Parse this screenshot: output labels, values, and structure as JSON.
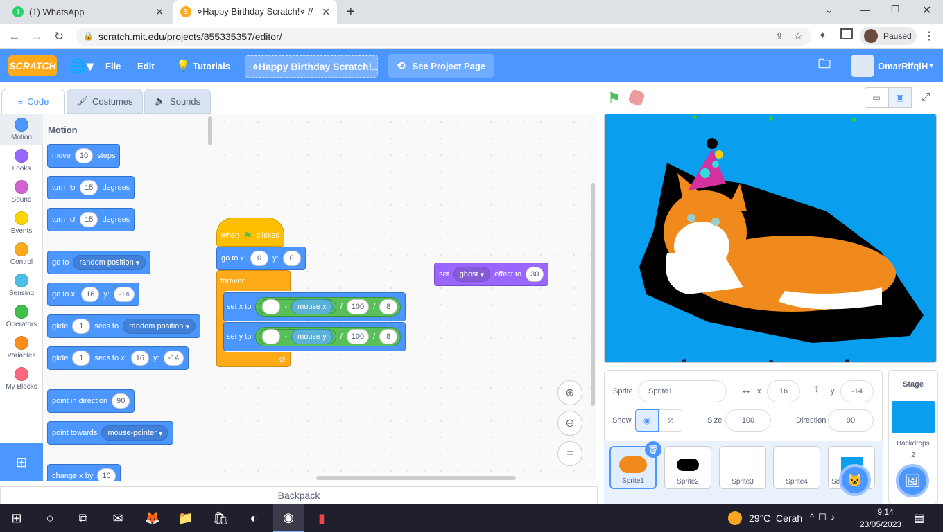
{
  "browser": {
    "tabs": [
      {
        "title": "(1) WhatsApp",
        "badge": "1"
      },
      {
        "title": "⋄Happy Birthday Scratch!⋄ // Sc"
      }
    ],
    "url": "scratch.mit.edu/projects/855335357/editor/",
    "profile_status": "Paused"
  },
  "menu": {
    "logo": "SCRATCH",
    "file": "File",
    "edit": "Edit",
    "tutorials": "Tutorials",
    "project_title": "⋄Happy Birthday Scratch!...",
    "see_project_page": "See Project Page",
    "username": "OmarRifqiH"
  },
  "editor_tabs": [
    "Code",
    "Costumes",
    "Sounds"
  ],
  "categories": [
    {
      "label": "Motion",
      "color": "#4c97ff"
    },
    {
      "label": "Looks",
      "color": "#9966ff"
    },
    {
      "label": "Sound",
      "color": "#cf63cf"
    },
    {
      "label": "Events",
      "color": "#ffd500"
    },
    {
      "label": "Control",
      "color": "#ffab19"
    },
    {
      "label": "Sensing",
      "color": "#4cbfe6"
    },
    {
      "label": "Operators",
      "color": "#40bf4a"
    },
    {
      "label": "Variables",
      "color": "#ff8c1a"
    },
    {
      "label": "My Blocks",
      "color": "#ff6680"
    }
  ],
  "palette": {
    "heading": "Motion",
    "move": {
      "a": "move",
      "v": "10",
      "b": "steps"
    },
    "turn_right": {
      "a": "turn",
      "v": "15",
      "b": "degrees"
    },
    "turn_left": {
      "a": "turn",
      "v": "15",
      "b": "degrees"
    },
    "goto": {
      "a": "go to",
      "dd": "random position"
    },
    "gotoxy": {
      "a": "go to x:",
      "x": "16",
      "b": "y:",
      "y": "-14"
    },
    "glide": {
      "a": "glide",
      "v": "1",
      "b": "secs to",
      "dd": "random position"
    },
    "glidexy": {
      "a": "glide",
      "v": "1",
      "b": "secs to x:",
      "x": "16",
      "c": "y:",
      "y": "-14"
    },
    "point_dir": {
      "a": "point in direction",
      "v": "90"
    },
    "point_towards": {
      "a": "point towards",
      "dd": "mouse-pointer"
    },
    "change_x": {
      "a": "change x by",
      "v": "10"
    }
  },
  "script": {
    "hat": {
      "a": "when",
      "b": "clicked"
    },
    "goto": {
      "a": "go to x:",
      "x": "0",
      "b": "y:",
      "y": "0"
    },
    "forever": "forever",
    "setx": {
      "a": "set x to",
      "op": "-",
      "sensor": "mouse x",
      "div": "/",
      "v1": "100",
      "v2": "8"
    },
    "sety": {
      "a": "set y to",
      "op": "-",
      "sensor": "mouse y",
      "div": "/",
      "v1": "100",
      "v2": "8"
    },
    "effect": {
      "a": "set",
      "dd": "ghost",
      "b": "effect to",
      "v": "30"
    }
  },
  "backpack": "Backpack",
  "sprite_info": {
    "label_sprite": "Sprite",
    "name": "Sprite1",
    "x_label": "x",
    "x": "16",
    "y_label": "y",
    "y": "-14",
    "show_label": "Show",
    "size_label": "Size",
    "size": "100",
    "direction_label": "Direction",
    "direction": "90"
  },
  "sprites": [
    "Sprite1",
    "Sprite2",
    "Sprite3",
    "Sprite4",
    "Sc"
  ],
  "stage_panel": {
    "title": "Stage",
    "backdrops_label": "Backdrops",
    "backdrops_count": "2"
  },
  "taskbar": {
    "weather": "29°C  Cerah",
    "time": "9:14",
    "date": "23/05/2023"
  },
  "colors": {
    "scratch_blue": "#4c97ff",
    "stage_bg": "#0a9fee"
  }
}
